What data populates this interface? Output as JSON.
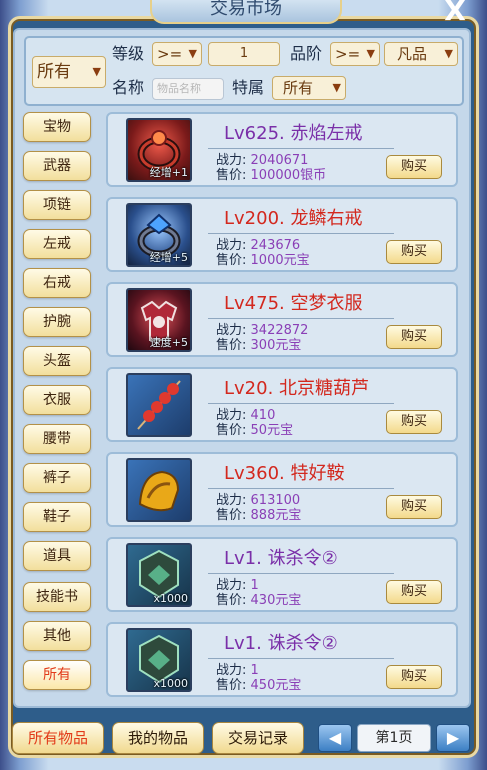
{
  "window": {
    "title": "交易市场",
    "close_label": "X"
  },
  "filter": {
    "category_value": "所有",
    "level_label": "等级",
    "level_op": ">=",
    "level_value": "1",
    "grade_label": "品阶",
    "grade_op": ">=",
    "grade_value": "凡品",
    "name_label": "名称",
    "name_placeholder": "物品名称",
    "attr_label": "特属",
    "attr_value": "所有"
  },
  "categories": [
    "宝物",
    "武器",
    "项链",
    "左戒",
    "右戒",
    "护腕",
    "头盔",
    "衣服",
    "腰带",
    "裤子",
    "鞋子",
    "道具",
    "技能书",
    "其他",
    "所有"
  ],
  "selected_category": "所有",
  "stat_labels": {
    "power": "战力:",
    "price": "售价:"
  },
  "buy_label": "购买",
  "items": [
    {
      "name": "Lv625. 赤焰左戒",
      "name_color": "#7a2fa8",
      "power": "2040671",
      "price": "100000银币",
      "badge": "经增+1",
      "icon": "ring-icon"
    },
    {
      "name": "Lv200. 龙鳞右戒",
      "name_color": "#d3281e",
      "power": "243676",
      "price": "1000元宝",
      "badge": "经增+5",
      "icon": "ring-icon"
    },
    {
      "name": "Lv475. 空梦衣服",
      "name_color": "#d3281e",
      "power": "3422872",
      "price": "300元宝",
      "badge": "速度+5",
      "icon": "armor-icon"
    },
    {
      "name": "Lv20. 北京糖葫芦",
      "name_color": "#d3281e",
      "power": "410",
      "price": "50元宝",
      "badge": "",
      "icon": "candied-haws-icon"
    },
    {
      "name": "Lv360. 特好鞍",
      "name_color": "#d3281e",
      "power": "613100",
      "price": "888元宝",
      "badge": "",
      "icon": "saddle-icon"
    },
    {
      "name": "Lv1. 诛杀令②",
      "name_color": "#7a2fa8",
      "power": "1",
      "price": "430元宝",
      "badge": "x1000",
      "icon": "token-icon"
    },
    {
      "name": "Lv1. 诛杀令②",
      "name_color": "#7a2fa8",
      "power": "1",
      "price": "450元宝",
      "badge": "x1000",
      "icon": "token-icon"
    }
  ],
  "bottom": {
    "tab_all": "所有物品",
    "tab_mine": "我的物品",
    "tab_log": "交易记录",
    "page_label": "第1页"
  },
  "colors": {
    "accent_red": "#e23b1a",
    "name_purple": "#7a2fa8",
    "name_red": "#d3281e",
    "value_purple": "#8a3fb6"
  }
}
